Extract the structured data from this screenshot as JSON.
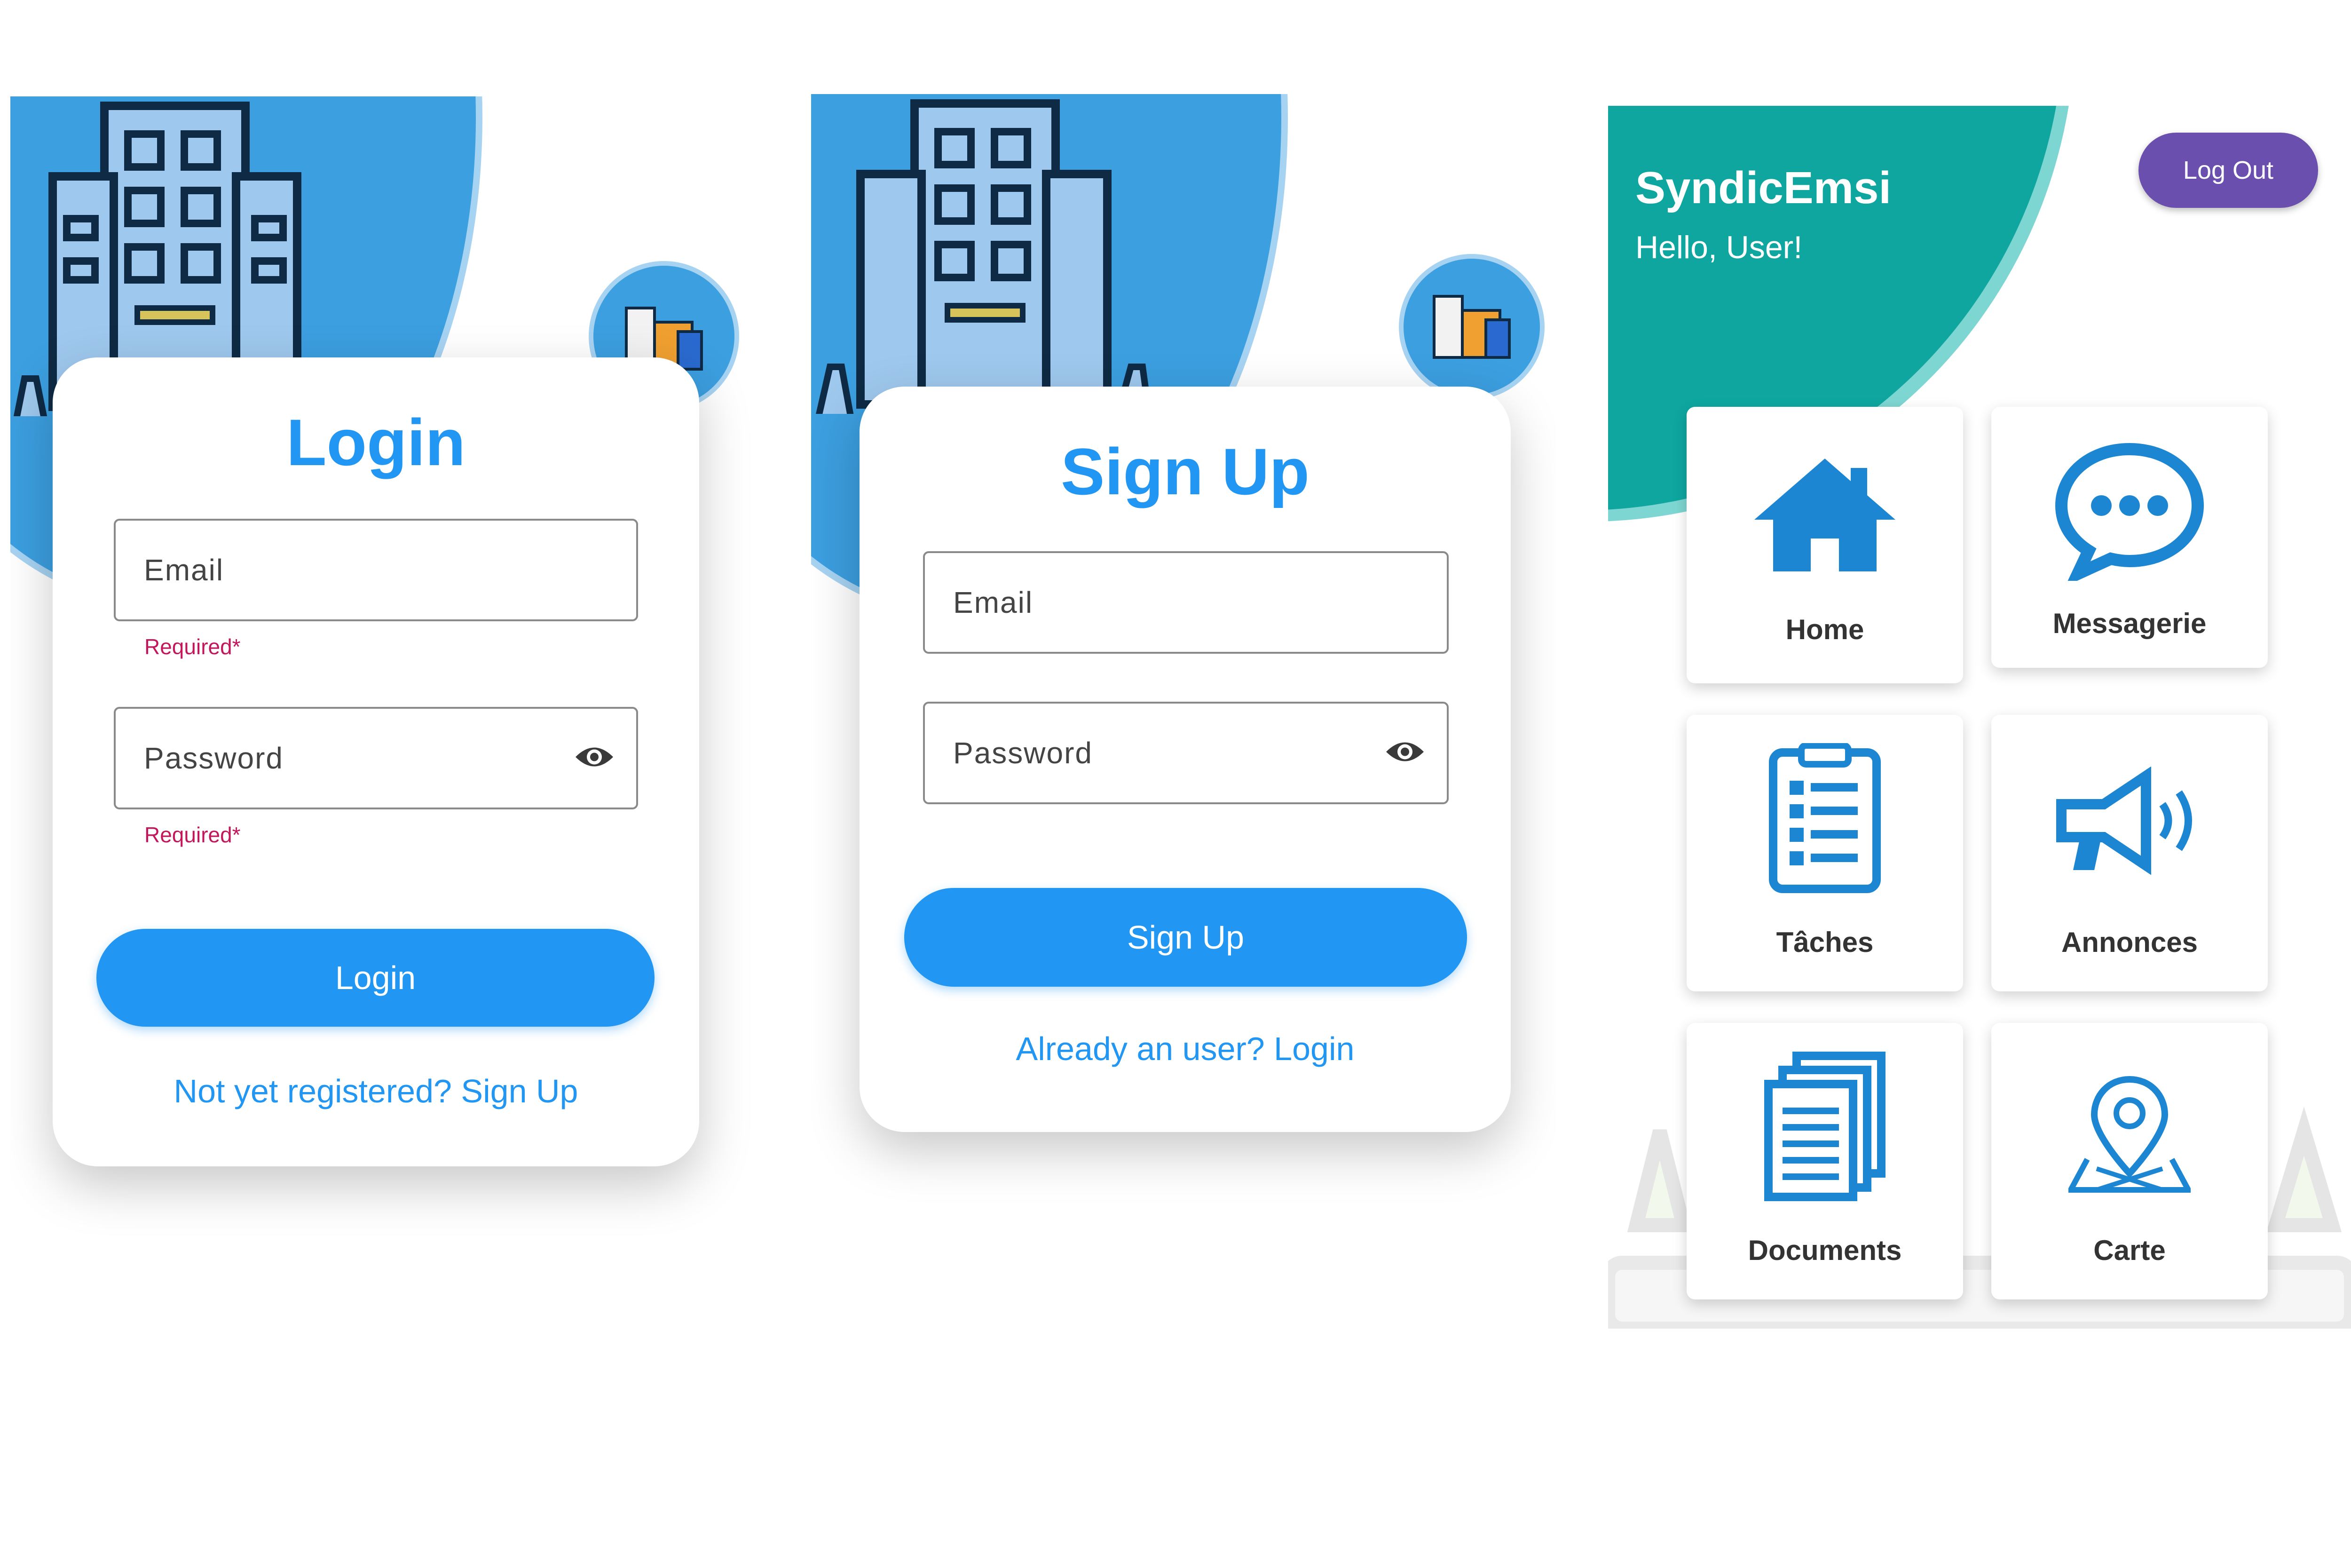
{
  "login_screen": {
    "title": "Login",
    "email_placeholder": "Email",
    "email_error": "Required*",
    "password_placeholder": "Password",
    "password_error": "Required*",
    "button_label": "Login",
    "signup_link": "Not yet registered? Sign Up"
  },
  "signup_screen": {
    "title": "Sign Up",
    "email_placeholder": "Email",
    "password_placeholder": "Password",
    "button_label": "Sign Up",
    "login_link": "Already an user? Login"
  },
  "dashboard": {
    "app_name": "SyndicEmsi",
    "greeting": "Hello, User!",
    "logout_label": "Log Out",
    "tiles": [
      {
        "label": "Home",
        "icon": "home-icon"
      },
      {
        "label": "Messagerie",
        "icon": "chat-bubble-icon"
      },
      {
        "label": "Tâches",
        "icon": "clipboard-list-icon"
      },
      {
        "label": "Annonces",
        "icon": "megaphone-icon"
      },
      {
        "label": "Documents",
        "icon": "documents-icon"
      },
      {
        "label": "Carte",
        "icon": "map-pin-icon"
      }
    ]
  },
  "colors": {
    "primary": "#2196f3",
    "header_teal": "#0fa6a0",
    "logout_purple": "#6a4fae",
    "error": "#c2185b",
    "header_blob": "#3a9ee0"
  }
}
